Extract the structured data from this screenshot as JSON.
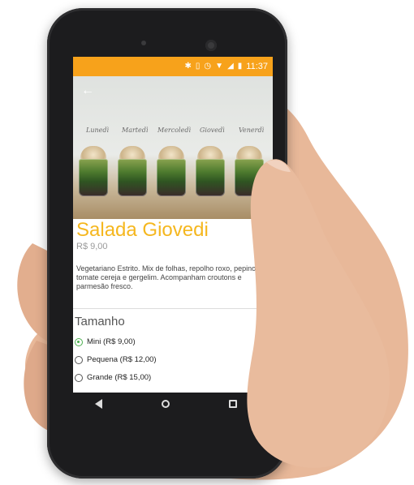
{
  "status_bar": {
    "time": "11:37",
    "icons": [
      "bluetooth-icon",
      "vibrate-icon",
      "alarm-icon",
      "wifi-icon",
      "signal-icon",
      "battery-icon"
    ],
    "color": "#f7a21b"
  },
  "hero": {
    "back_icon": "back-arrow-icon",
    "day_labels": [
      "Lunedì",
      "Martedì",
      "Mercoledì",
      "Giovedì",
      "Venerdì"
    ]
  },
  "product": {
    "title": "Salada Giovedi",
    "price": "R$ 9,00",
    "description": "Vegetariano Estrito. Mix de folhas, repolho roxo, pepino, tomate cereja e gergelim. Acompanham croutons e parmesão fresco.",
    "title_color": "#f5b71f"
  },
  "size_section": {
    "title": "Tamanho",
    "options": [
      {
        "label": "Mini (R$ 9,00)",
        "selected": true
      },
      {
        "label": "Pequena (R$ 12,00)",
        "selected": false
      },
      {
        "label": "Grande (R$ 15,00)",
        "selected": false
      }
    ],
    "accent_color": "#4caf50"
  },
  "nav_bar": {
    "icons": [
      "back-triangle-icon",
      "home-circle-icon",
      "recents-square-icon"
    ]
  }
}
